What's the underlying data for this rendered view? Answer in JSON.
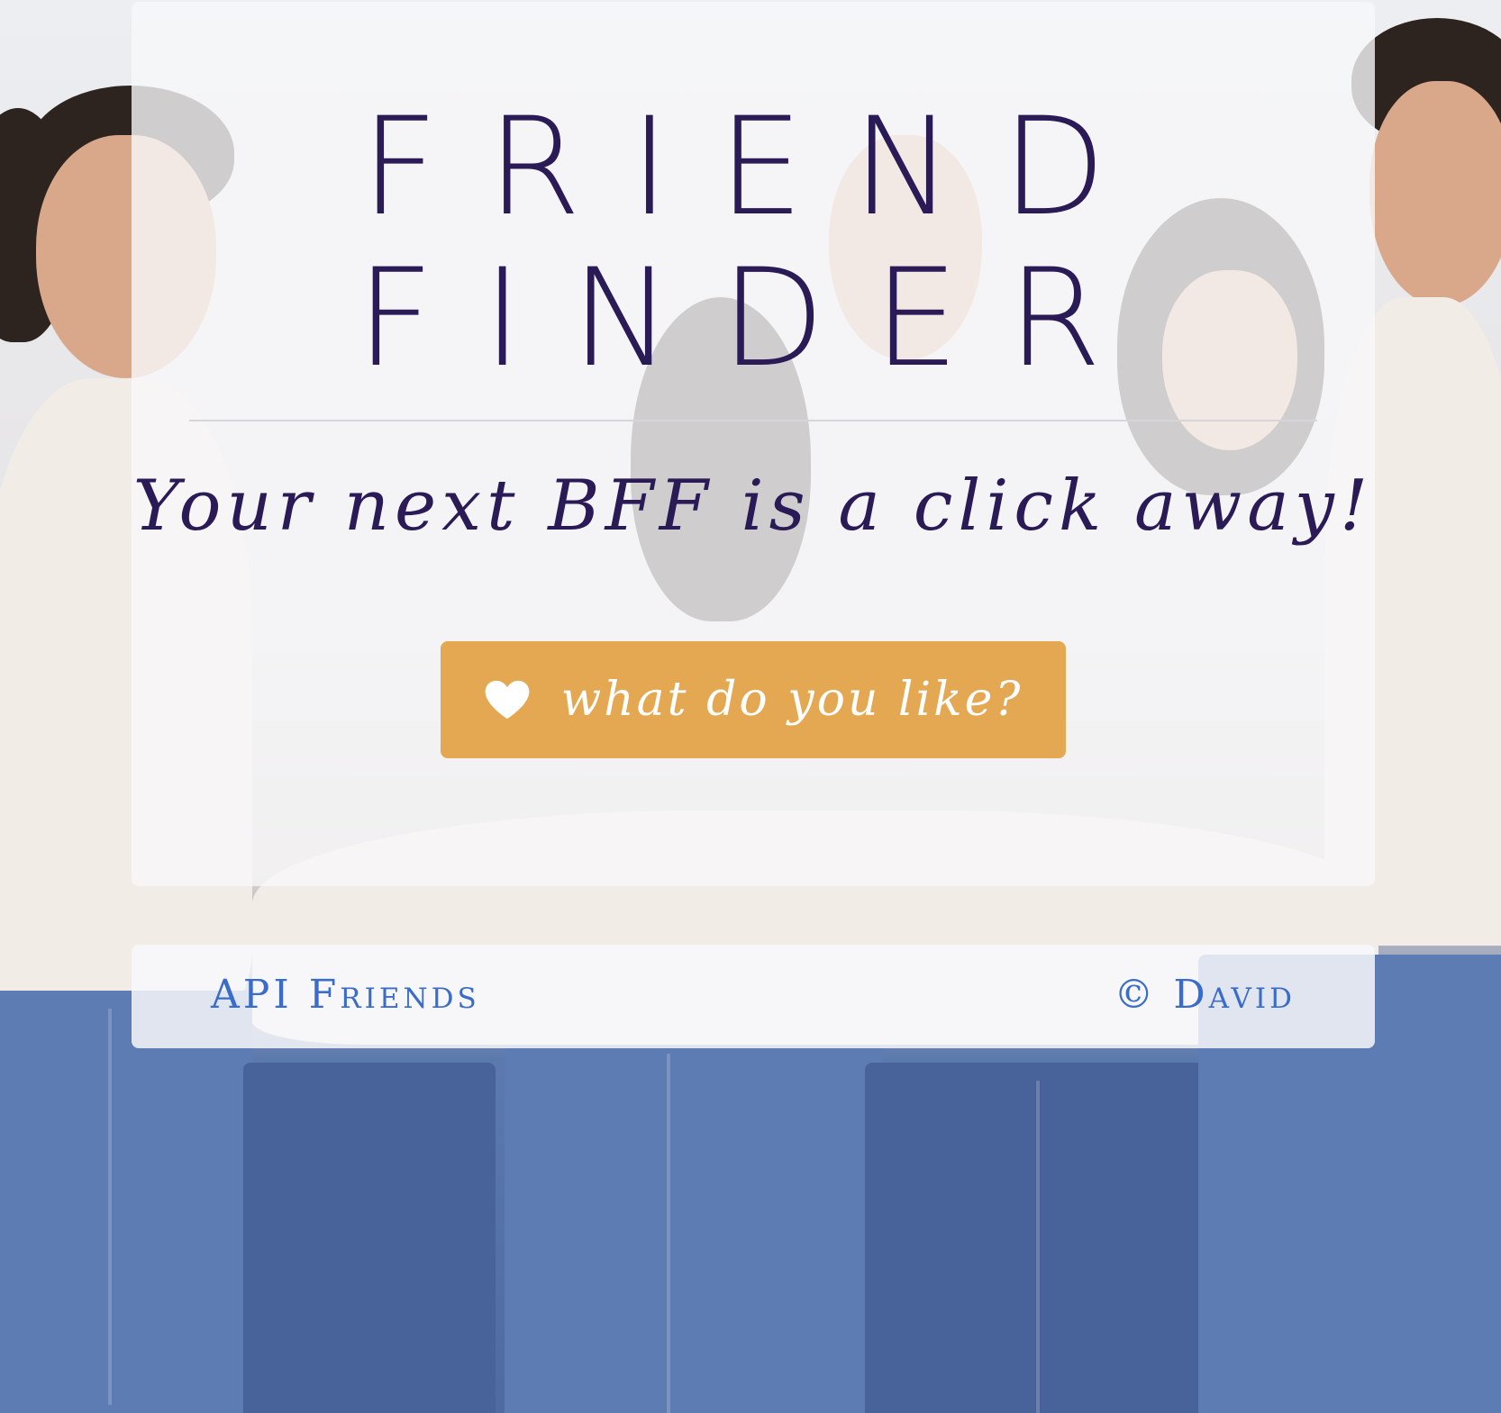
{
  "hero": {
    "title_line1": "FRIEND",
    "title_line2": "FINDER",
    "tagline": "Your next BFF is a click away!",
    "cta": {
      "label": "what do you like?",
      "icon": "heart-icon",
      "color": "#e3a851"
    }
  },
  "footer": {
    "left_link": "API Friends",
    "right_text": "© David"
  },
  "colors": {
    "title": "#2a1a55",
    "link": "#3a6cc9",
    "panel": "rgba(248,248,250,0.8)"
  }
}
